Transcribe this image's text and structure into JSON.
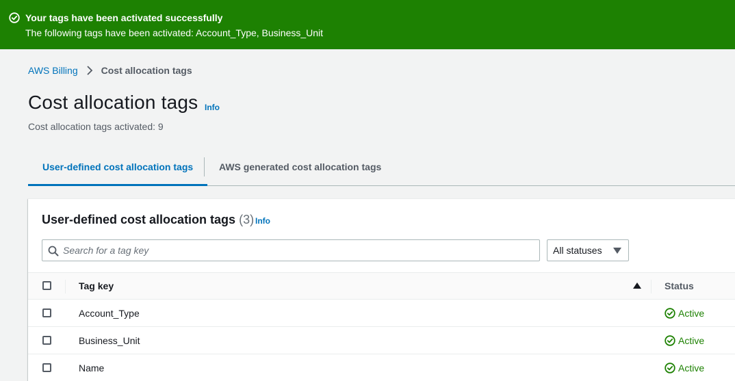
{
  "flash": {
    "title": "Your tags have been activated successfully",
    "message": "The following tags have been activated: Account_Type, Business_Unit",
    "icon": "check-circle-icon",
    "color": "#1d8102"
  },
  "breadcrumb": {
    "root": "AWS Billing",
    "current": "Cost allocation tags"
  },
  "header": {
    "title": "Cost allocation tags",
    "info": "Info",
    "description": "Cost allocation tags activated: 9"
  },
  "tabs": [
    {
      "label": "User-defined cost allocation tags",
      "active": true
    },
    {
      "label": "AWS generated cost allocation tags",
      "active": false
    }
  ],
  "table": {
    "title": "User-defined cost allocation tags",
    "count": "(3)",
    "info": "Info",
    "search_placeholder": "Search for a tag key",
    "status_filter": "All statuses",
    "columns": {
      "key": "Tag key",
      "status": "Status"
    },
    "rows": [
      {
        "key": "Account_Type",
        "status": "Active"
      },
      {
        "key": "Business_Unit",
        "status": "Active"
      },
      {
        "key": "Name",
        "status": "Active"
      }
    ]
  },
  "colors": {
    "accent": "#0073bb",
    "success": "#1d8102"
  }
}
